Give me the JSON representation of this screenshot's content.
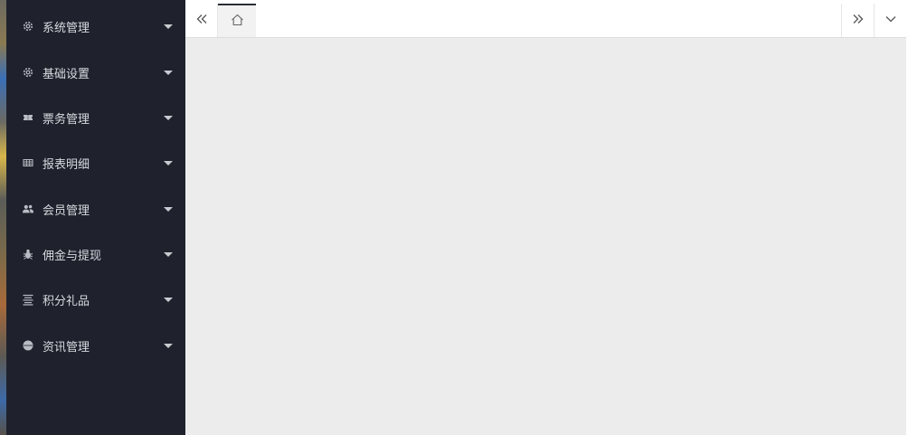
{
  "sidebar": {
    "items": [
      {
        "label": "系统管理",
        "icon": "gear-icon"
      },
      {
        "label": "基础设置",
        "icon": "gear-icon"
      },
      {
        "label": "票务管理",
        "icon": "ticket-icon"
      },
      {
        "label": "报表明细",
        "icon": "table-icon"
      },
      {
        "label": "会员管理",
        "icon": "users-icon"
      },
      {
        "label": "佣金与提现",
        "icon": "bug-icon"
      },
      {
        "label": "积分礼品",
        "icon": "list-icon"
      },
      {
        "label": "资讯管理",
        "icon": "circle-icon"
      }
    ]
  },
  "topbar": {
    "left_button_icon": "double-chevron-left-icon",
    "home_tab_icon": "home-icon",
    "right_button_icon": "double-chevron-right-icon",
    "menu_button_icon": "chevron-down-icon"
  },
  "colors": {
    "sidebar_bg": "#1f222d",
    "sidebar_text": "#d8dae0",
    "content_bg": "#ececec",
    "topbar_bg": "#ffffff"
  }
}
